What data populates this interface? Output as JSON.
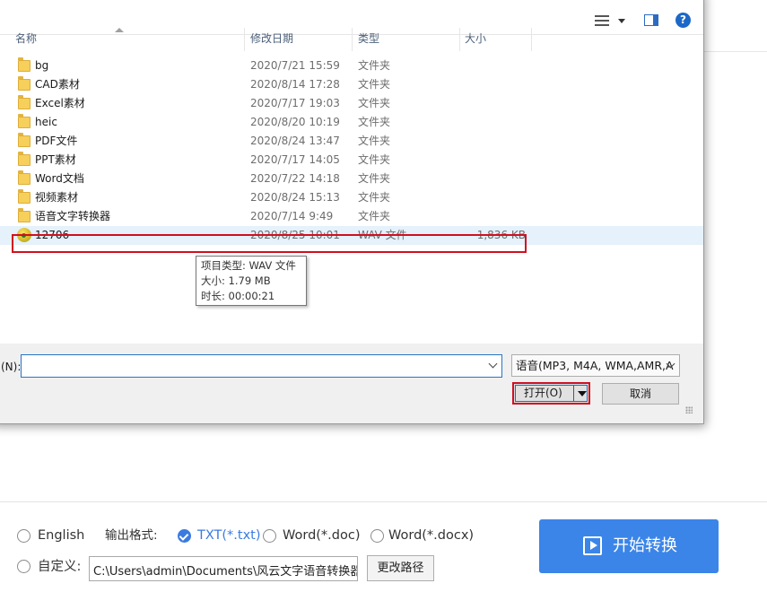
{
  "dialog": {
    "columns": {
      "name": "名称",
      "date": "修改日期",
      "type": "类型",
      "size": "大小"
    },
    "files": [
      {
        "name": "bg",
        "date": "2020/7/21 15:59",
        "type": "文件夹",
        "size": ""
      },
      {
        "name": "CAD素材",
        "date": "2020/8/14 17:28",
        "type": "文件夹",
        "size": ""
      },
      {
        "name": "Excel素材",
        "date": "2020/7/17 19:03",
        "type": "文件夹",
        "size": ""
      },
      {
        "name": "heic",
        "date": "2020/8/20 10:19",
        "type": "文件夹",
        "size": ""
      },
      {
        "name": "PDF文件",
        "date": "2020/8/24 13:47",
        "type": "文件夹",
        "size": ""
      },
      {
        "name": "PPT素材",
        "date": "2020/7/17 14:05",
        "type": "文件夹",
        "size": ""
      },
      {
        "name": "Word文档",
        "date": "2020/7/22 14:18",
        "type": "文件夹",
        "size": ""
      },
      {
        "name": "视频素材",
        "date": "2020/8/24 15:13",
        "type": "文件夹",
        "size": ""
      },
      {
        "name": "语音文字转换器",
        "date": "2020/7/14 9:49",
        "type": "文件夹",
        "size": ""
      },
      {
        "name": "12706",
        "date": "2020/8/25 10:01",
        "type": "WAV 文件",
        "size": "1,836 KB",
        "selected": true
      }
    ],
    "tooltip": {
      "line1": "项目类型: WAV 文件",
      "line2": "大小: 1.79 MB",
      "line3": "时长: 00:00:21"
    },
    "filename_label": "名(N):",
    "filename_value": "",
    "filter_value": "语音(MP3, M4A, WMA,AMR,A",
    "open_label": "打开(O)",
    "cancel_label": "取消",
    "help_glyph": "?"
  },
  "app": {
    "lang_option": "English",
    "output_format_label": "输出格式:",
    "formats": [
      {
        "label": "TXT(*.txt)",
        "checked": true
      },
      {
        "label": "Word(*.doc)",
        "checked": false
      },
      {
        "label": "Word(*.docx)",
        "checked": false
      }
    ],
    "custom_label": "自定义:",
    "output_path": "C:\\Users\\admin\\Documents\\风云文字语音转换器",
    "change_path_label": "更改路径",
    "start_label": "开始转换"
  },
  "colors": {
    "accent": "#3b85e9",
    "highlight_border": "#d01020",
    "selection": "#e5f1fb"
  }
}
